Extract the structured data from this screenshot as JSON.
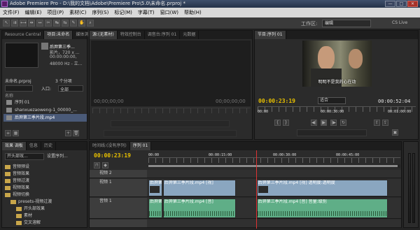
{
  "window": {
    "title": "Adobe Premiere Pro - D:\\我的文档\\Adobe\\Premiere Pro\\5.0\\未命名.prproj *",
    "minimize": "—",
    "maximize": "□",
    "close": "✕"
  },
  "menu": [
    "文件(F)",
    "编辑(E)",
    "项目(P)",
    "素材(C)",
    "序列(S)",
    "标记(M)",
    "字幕(T)",
    "窗口(W)",
    "帮助(H)"
  ],
  "toolbar": {
    "workspace_label": "工作区:",
    "workspace_value": "编辑",
    "cs_live": "CS Live"
  },
  "project_panel": {
    "tabs": [
      "Resource Central",
      "项目:未命名",
      "媒体浏览"
    ],
    "clip_name": "后羿第三季...",
    "clip_info": [
      "影片，720 x ...",
      "00:00:00:00,",
      "48000 Hz - 立..."
    ],
    "project_file": "未命名.prproj",
    "item_count": "3 个分项",
    "search_label": "入口:",
    "search_value": "全部",
    "column_name": "名称",
    "items": [
      {
        "label": "序列 01",
        "selected": false
      },
      {
        "label": "shanxuezaoweng-1_00000_...",
        "selected": false
      },
      {
        "label": "后羿第三季片段.mp4",
        "selected": true
      }
    ]
  },
  "effects_panel": {
    "tabs": [
      "效果 调板",
      "信息",
      "历史"
    ],
    "dropdown1": "开头部效...",
    "dropdown2": "设置序列...",
    "items": [
      "音频预设",
      "音频效果",
      "音频过渡",
      "视频效果",
      "视频切换",
      "presets-视频过渡",
      "开头部效果",
      "素材",
      "交叉溶解",
      "擦除"
    ]
  },
  "source_panel": {
    "tabs": [
      "源:(无素材)",
      "特效控制台",
      "调音台:序列 01",
      "元数据"
    ],
    "timecode_left": "00;00;00;00",
    "timecode_right": "00;00;00;00"
  },
  "program_panel": {
    "tab": "节目:序列 01",
    "subtitle": "明明不是我的心在动",
    "current_time": "00:00:23:19",
    "fit": "适合",
    "duration": "00:00:52:04",
    "ruler_labels": [
      "00:00",
      "00:00:30:00",
      "00:01:00:00"
    ]
  },
  "timeline_panel": {
    "tabs": [
      "时间线:(没有序列)",
      "序列 01"
    ],
    "current_time": "00:00:23:19",
    "ruler_labels": [
      "00:00",
      "00:00:15:00",
      "00:00:30:00",
      "00:00:45:00"
    ],
    "tracks": [
      {
        "name": "视频 2",
        "type": "video",
        "clips": []
      },
      {
        "name": "视频 1",
        "type": "video",
        "clips": [
          {
            "label": "后羿第",
            "left": 0.0,
            "width": 0.055
          },
          {
            "label": "后羿第三季片段.mp4 [视]",
            "left": 0.058,
            "width": 0.29
          },
          {
            "label": "后羿第三季片段.mp4 [视]  透明度:透明度",
            "left": 0.43,
            "width": 0.52
          }
        ]
      },
      {
        "name": "音频 1",
        "type": "audio",
        "clips": [
          {
            "label": "后羿第",
            "left": 0.0,
            "width": 0.055
          },
          {
            "label": "后羿第三季片段.mp4 [音]",
            "left": 0.058,
            "width": 0.29
          },
          {
            "label": "后羿第三季片段.mp4 [音]  音量:级别",
            "left": 0.43,
            "width": 0.52
          }
        ]
      }
    ]
  },
  "audio_meter": {
    "labels": [
      "0",
      "-12",
      "-24",
      "-36",
      "dB"
    ]
  }
}
